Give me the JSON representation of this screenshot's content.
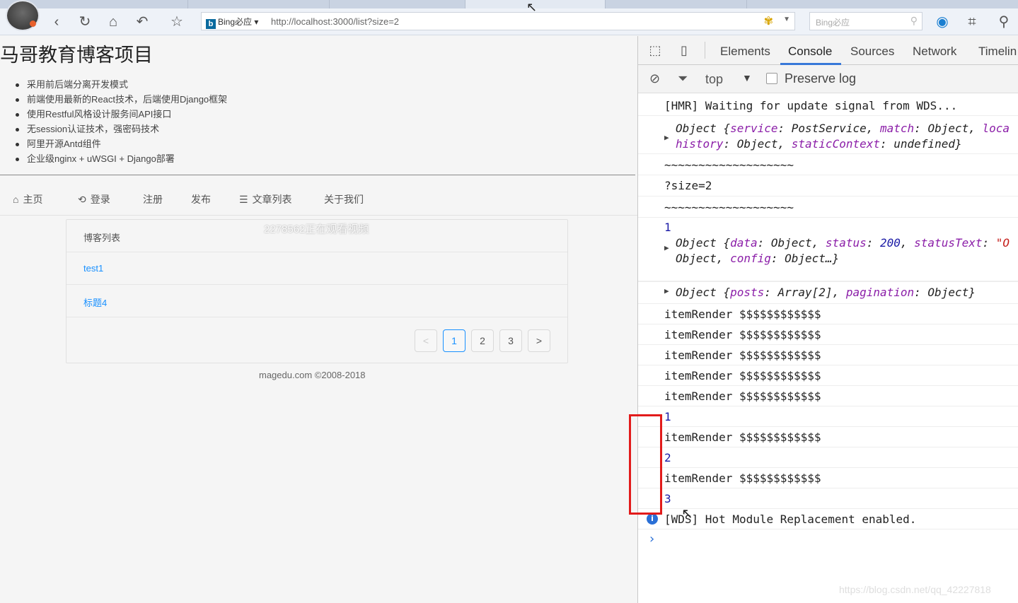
{
  "browser": {
    "search_engine": "Bing必应",
    "url": "http://localhost:3000/list?size=2",
    "search_placeholder": "Bing必应",
    "icons": {
      "back": "back-arrow-icon",
      "refresh": "refresh-icon",
      "home": "home-icon",
      "undo": "undo-icon",
      "favorite": "star-icon"
    }
  },
  "page": {
    "title": "马哥教育博客项目",
    "features": [
      "采用前后端分离开发模式",
      "前端使用最新的React技术，后端使用Django框架",
      "使用Restful风格设计服务间API接口",
      "无session认证技术，强密码技术",
      "阿里开源Antd组件",
      "企业级nginx + uWSGI + Django部署"
    ],
    "menu": {
      "home": "主页",
      "login": "登录",
      "register": "注册",
      "publish": "发布",
      "articles": "文章列表",
      "about": "关于我们"
    },
    "list": {
      "header": "博客列表",
      "items": [
        "test1",
        "标题4"
      ]
    },
    "watermark": "2278562正在观看视频",
    "pagination": {
      "prev": "<",
      "pages": [
        "1",
        "2",
        "3"
      ],
      "current": 1,
      "next": ">"
    },
    "footer": "magedu.com ©2008-2018"
  },
  "devtools": {
    "tabs": [
      "Elements",
      "Console",
      "Sources",
      "Network",
      "Timelin"
    ],
    "active_tab": "Console",
    "filter": {
      "context": "top",
      "preserve_log": "Preserve log"
    },
    "console": {
      "hmr": "[HMR] Waiting for update signal from WDS...",
      "obj1_line1_pre": "Object {",
      "obj1_k1": "service",
      "obj1_v1": ": PostService, ",
      "obj1_k2": "match",
      "obj1_v2": ": Object, ",
      "obj1_k3": "loca",
      "obj1_line2_k1": "history",
      "obj1_line2_v1": ": Object, ",
      "obj1_line2_k2": "staticContext",
      "obj1_line2_v2": ": undefined}",
      "tilde1": "~~~~~~~~~~~~~~~~~~~",
      "query": "?size=2",
      "tilde2": "~~~~~~~~~~~~~~~~~~~",
      "num1": "1",
      "obj2_pre": "Object {",
      "obj2_k1": "data",
      "obj2_v1": ": Object, ",
      "obj2_k2": "status",
      "obj2_v2_sep": ": ",
      "obj2_v2": "200",
      "obj2_sep2": ", ",
      "obj2_k3": "statusText",
      "obj2_v3_sep": ": ",
      "obj2_v3": "\"O",
      "obj2_line2_pre": "Object, ",
      "obj2_line2_k": "config",
      "obj2_line2_v": ": Object…}",
      "obj3_pre": "Object {",
      "obj3_k1": "posts",
      "obj3_v1": ": Array[2], ",
      "obj3_k2": "pagination",
      "obj3_v2": ": Object}",
      "item_render": "itemRender $$$$$$$$$$$$",
      "log1": "1",
      "log2": "2",
      "log3": "3",
      "wds": "[WDS] Hot Module Replacement enabled."
    }
  },
  "overlay": {
    "csdn_watermark": "https://blog.csdn.net/qq_42227818"
  }
}
